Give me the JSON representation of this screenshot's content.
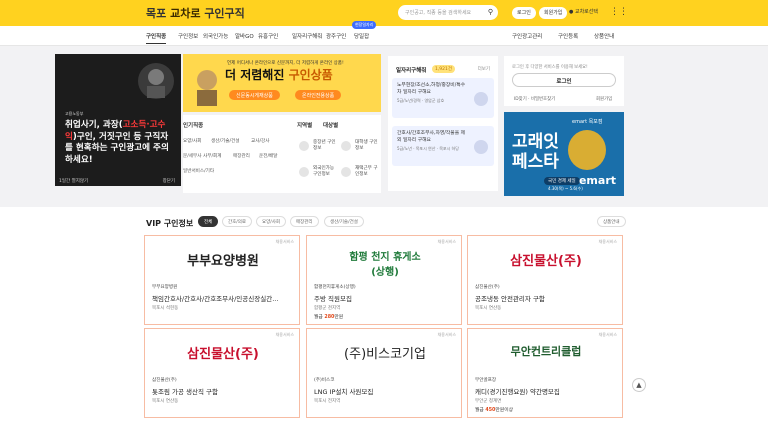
{
  "header": {
    "logo_region": "목포",
    "logo_main": "교차로",
    "logo_suffix": "구인구직",
    "search_placeholder": "구인공고, 직종 등을 검색하세요",
    "login_label": "로그인",
    "signup_label": "회원가입",
    "location_label": "교차로선택"
  },
  "nav": {
    "items": [
      "구인직종",
      "구인정보",
      "외국인가능",
      "알바GO",
      "유흥구인",
      "일자리구해줘",
      "광주구인",
      "당일잡"
    ],
    "new_badge": "현장일자리",
    "right_items": [
      "구인광고관리",
      "구인등록",
      "상품안내"
    ]
  },
  "popup": {
    "gov": "고용노동부",
    "text_a": "취업사기, 과장(",
    "text_red": "고소득·고수익",
    "text_b": ")구인, 거짓구인 등 구직자를 현혹하는 구인광고에 주의하세요!",
    "foot_left": "1일간 열지않기",
    "foot_right": "창닫기"
  },
  "banner": {
    "sub": "언제 어디서나 온라인으로 신문까지, 더 저렴하게 온라인 상품!",
    "title_a": "더 저렴해진 ",
    "title_b": "구인상품",
    "btn1": "신문동시게재상품",
    "btn2": "온라인전용상품"
  },
  "categories": {
    "title": "인기직종",
    "items": [
      "요양/사회",
      "생산/기술/건설",
      "교사/강사",
      "문/세무사",
      "사무/회계",
      "매장관리",
      "운전/배달",
      "일반서비스/기타"
    ],
    "region_title": "지역별",
    "target_title": "대상별",
    "figures": [
      "중장년 구인정보",
      "대학생 구인정보",
      "외국인가능 구인정보",
      "재택근무 구인정보"
    ]
  },
  "weekly": {
    "title": "일자리구해줘",
    "count": "1,921건",
    "more": "더보기",
    "cards": [
      {
        "text": "노무현장/조선소,하청/중장비/특수차 일자리 구해요",
        "meta": "5급/노년/경력 · 영암군 삼호"
      },
      {
        "text": "간호사/간호조무사,자영/작물을 제외 일자리 구해요",
        "meta": "5급/노년 · 목포시 연산 · 목포시 하당"
      }
    ]
  },
  "login": {
    "tip": "로그인 후 다양한 서비스를 이용해 보세요!",
    "button": "로그인",
    "find": "ID찾기 · 비밀번호찾기",
    "join": "회원가입"
  },
  "ad": {
    "brand_top": "emart 목포점",
    "title": "고래잇 페스타",
    "sub": "국민 경제 세일",
    "date": "4.30(목) ~ 5.6(수)",
    "brand": "emart"
  },
  "vip": {
    "title": "VIP 구인정보",
    "tabs": [
      "전체",
      "간호/의료",
      "요양/사회",
      "매장관리",
      "생산/기술/건설"
    ],
    "sort": "상품안내",
    "jobs": [
      {
        "logo": "부부요양병원",
        "company": "부부요양병원",
        "title": "책임간호사/간호사/간호조무사/인공신장실간...",
        "place": "목포시 석현동",
        "pay_label": "",
        "pay_value": "",
        "pay_unit": ""
      },
      {
        "logo": "함평 천지 휴게소(상행)",
        "company": "함평천지휴게소(상행)",
        "title": "주방 직원모집",
        "place": "함평군 천지역",
        "pay_label": "월급",
        "pay_value": "280",
        "pay_unit": "만원"
      },
      {
        "logo": "삼진물산(주)",
        "company": "삼진물산(주)",
        "title": "공조냉동 안전관리자 구함",
        "place": "목포시 연산동",
        "pay_label": "",
        "pay_value": "",
        "pay_unit": ""
      },
      {
        "logo": "삼진물산(주)",
        "company": "삼진물산(주)",
        "title": "톳조림 가공 생산직 구함",
        "place": "목포시 연산동",
        "pay_label": "",
        "pay_value": "",
        "pay_unit": ""
      },
      {
        "logo": "(주)비스코기업",
        "company": "(주)비스코",
        "title": "LNG IP설치 사원모집",
        "place": "목포시 전지역",
        "pay_label": "",
        "pay_value": "",
        "pay_unit": ""
      },
      {
        "logo": "무안컨트리클럽",
        "company": "무안골프장",
        "title": "캐디(경기진행요원) 약간명모집",
        "place": "무안군 청계면",
        "pay_label": "월급",
        "pay_value": "450",
        "pay_unit": "만원이상"
      }
    ],
    "ad_tag": "채용서비스"
  }
}
